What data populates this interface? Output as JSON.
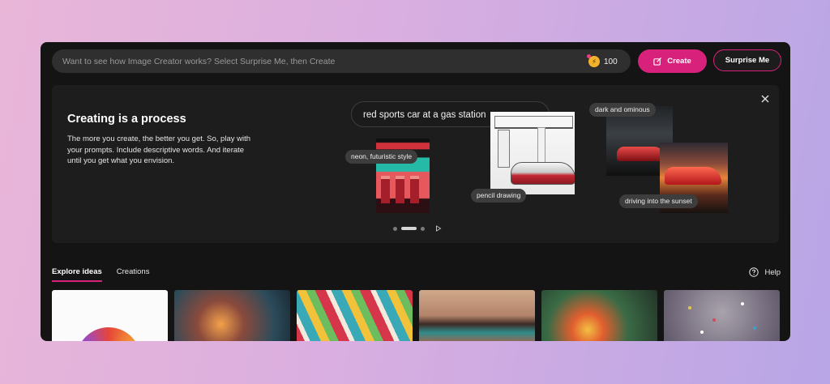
{
  "search": {
    "placeholder": "Want to see how Image Creator works? Select Surprise Me, then Create"
  },
  "coins": {
    "count": "100",
    "icon": "boost-coin-icon",
    "color": "#f2b22c"
  },
  "buttons": {
    "create_label": "Create",
    "surprise_label": "Surprise Me"
  },
  "colors": {
    "accent": "#d8217a",
    "window_bg": "#141414",
    "panel_bg": "#1d1d1d"
  },
  "promo": {
    "title": "Creating is a process",
    "body": "The more you create, the better you get. So, play with your prompts. Include descriptive words. And iterate until you get what you envision.",
    "prompt": "red sports car at a gas station",
    "tags": {
      "neon": "neon, futuristic style",
      "pencil": "pencil drawing",
      "dark": "dark and ominous",
      "sunset": "driving into the sunset"
    },
    "carousel": {
      "slides": 3,
      "active": 2
    }
  },
  "tabs": [
    {
      "label": "Explore ideas",
      "active": true
    },
    {
      "label": "Creations",
      "active": false
    }
  ],
  "help": {
    "label": "Help"
  }
}
